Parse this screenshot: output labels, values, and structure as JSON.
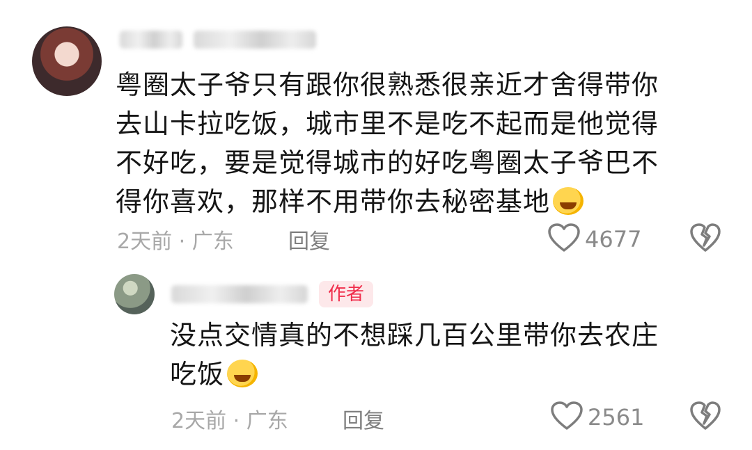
{
  "main_comment": {
    "lines": [
      "粤圈太子爷只有跟你很熟悉很亲近才舍得带你",
      "去山卡拉吃饭，城市里不是吃不起而是他觉得",
      "不好吃，要是觉得城市的好吃粤圈太子爷巴不",
      "得你喜欢，那样不用带你去秘密基地"
    ],
    "time_location": "2天前 · 广东",
    "reply_label": "回复",
    "likes": "4677"
  },
  "reply_comment": {
    "badge": "作者",
    "lines": [
      "没点交情真的不想踩几百公里带你去农庄",
      "吃饭"
    ],
    "time_location": "2天前 · 广东",
    "reply_label": "回复",
    "likes": "2561"
  },
  "icons": {
    "like": "heart-outline-icon",
    "dislike": "broken-heart-icon",
    "emoji_1": "rofl-emoji",
    "emoji_2": "thinking-emoji"
  },
  "colors": {
    "accent": "#f02d4b",
    "meta": "#a8a8a8"
  }
}
